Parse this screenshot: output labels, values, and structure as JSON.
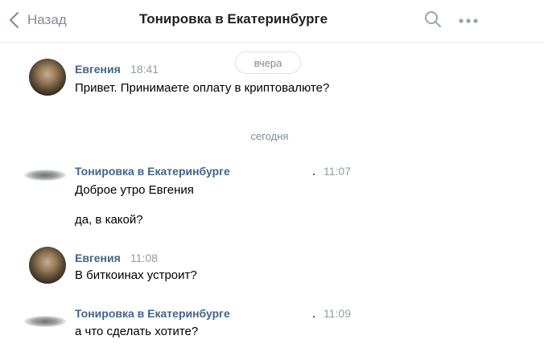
{
  "header": {
    "back_label": "Назад",
    "title": "Тонировка в Екатеринбурге",
    "icons": [
      "chevron-left-icon",
      "search-icon",
      "more-icon"
    ]
  },
  "days": {
    "yesterday": "вчера",
    "today": "сегодня"
  },
  "messages": [
    {
      "author": "Евгения",
      "time": "18:41",
      "text": "Привет. Принимаете оплату в криптовалюте?"
    },
    {
      "author": "Тонировка в Екатеринбурге",
      "time": "11:07",
      "texts": [
        "Доброе утро Евгения",
        "да, в какой?"
      ]
    },
    {
      "author": "Евгения",
      "time": "11:08",
      "text": "В биткоинах устроит?"
    },
    {
      "author": "Тонировка в Екатеринбурге",
      "time": "11:09",
      "text": "а что сделать хотите?"
    }
  ],
  "colors": {
    "link": "#42648b",
    "muted": "#828a99",
    "time": "#939ba6",
    "divider": "#e7e8ec"
  }
}
